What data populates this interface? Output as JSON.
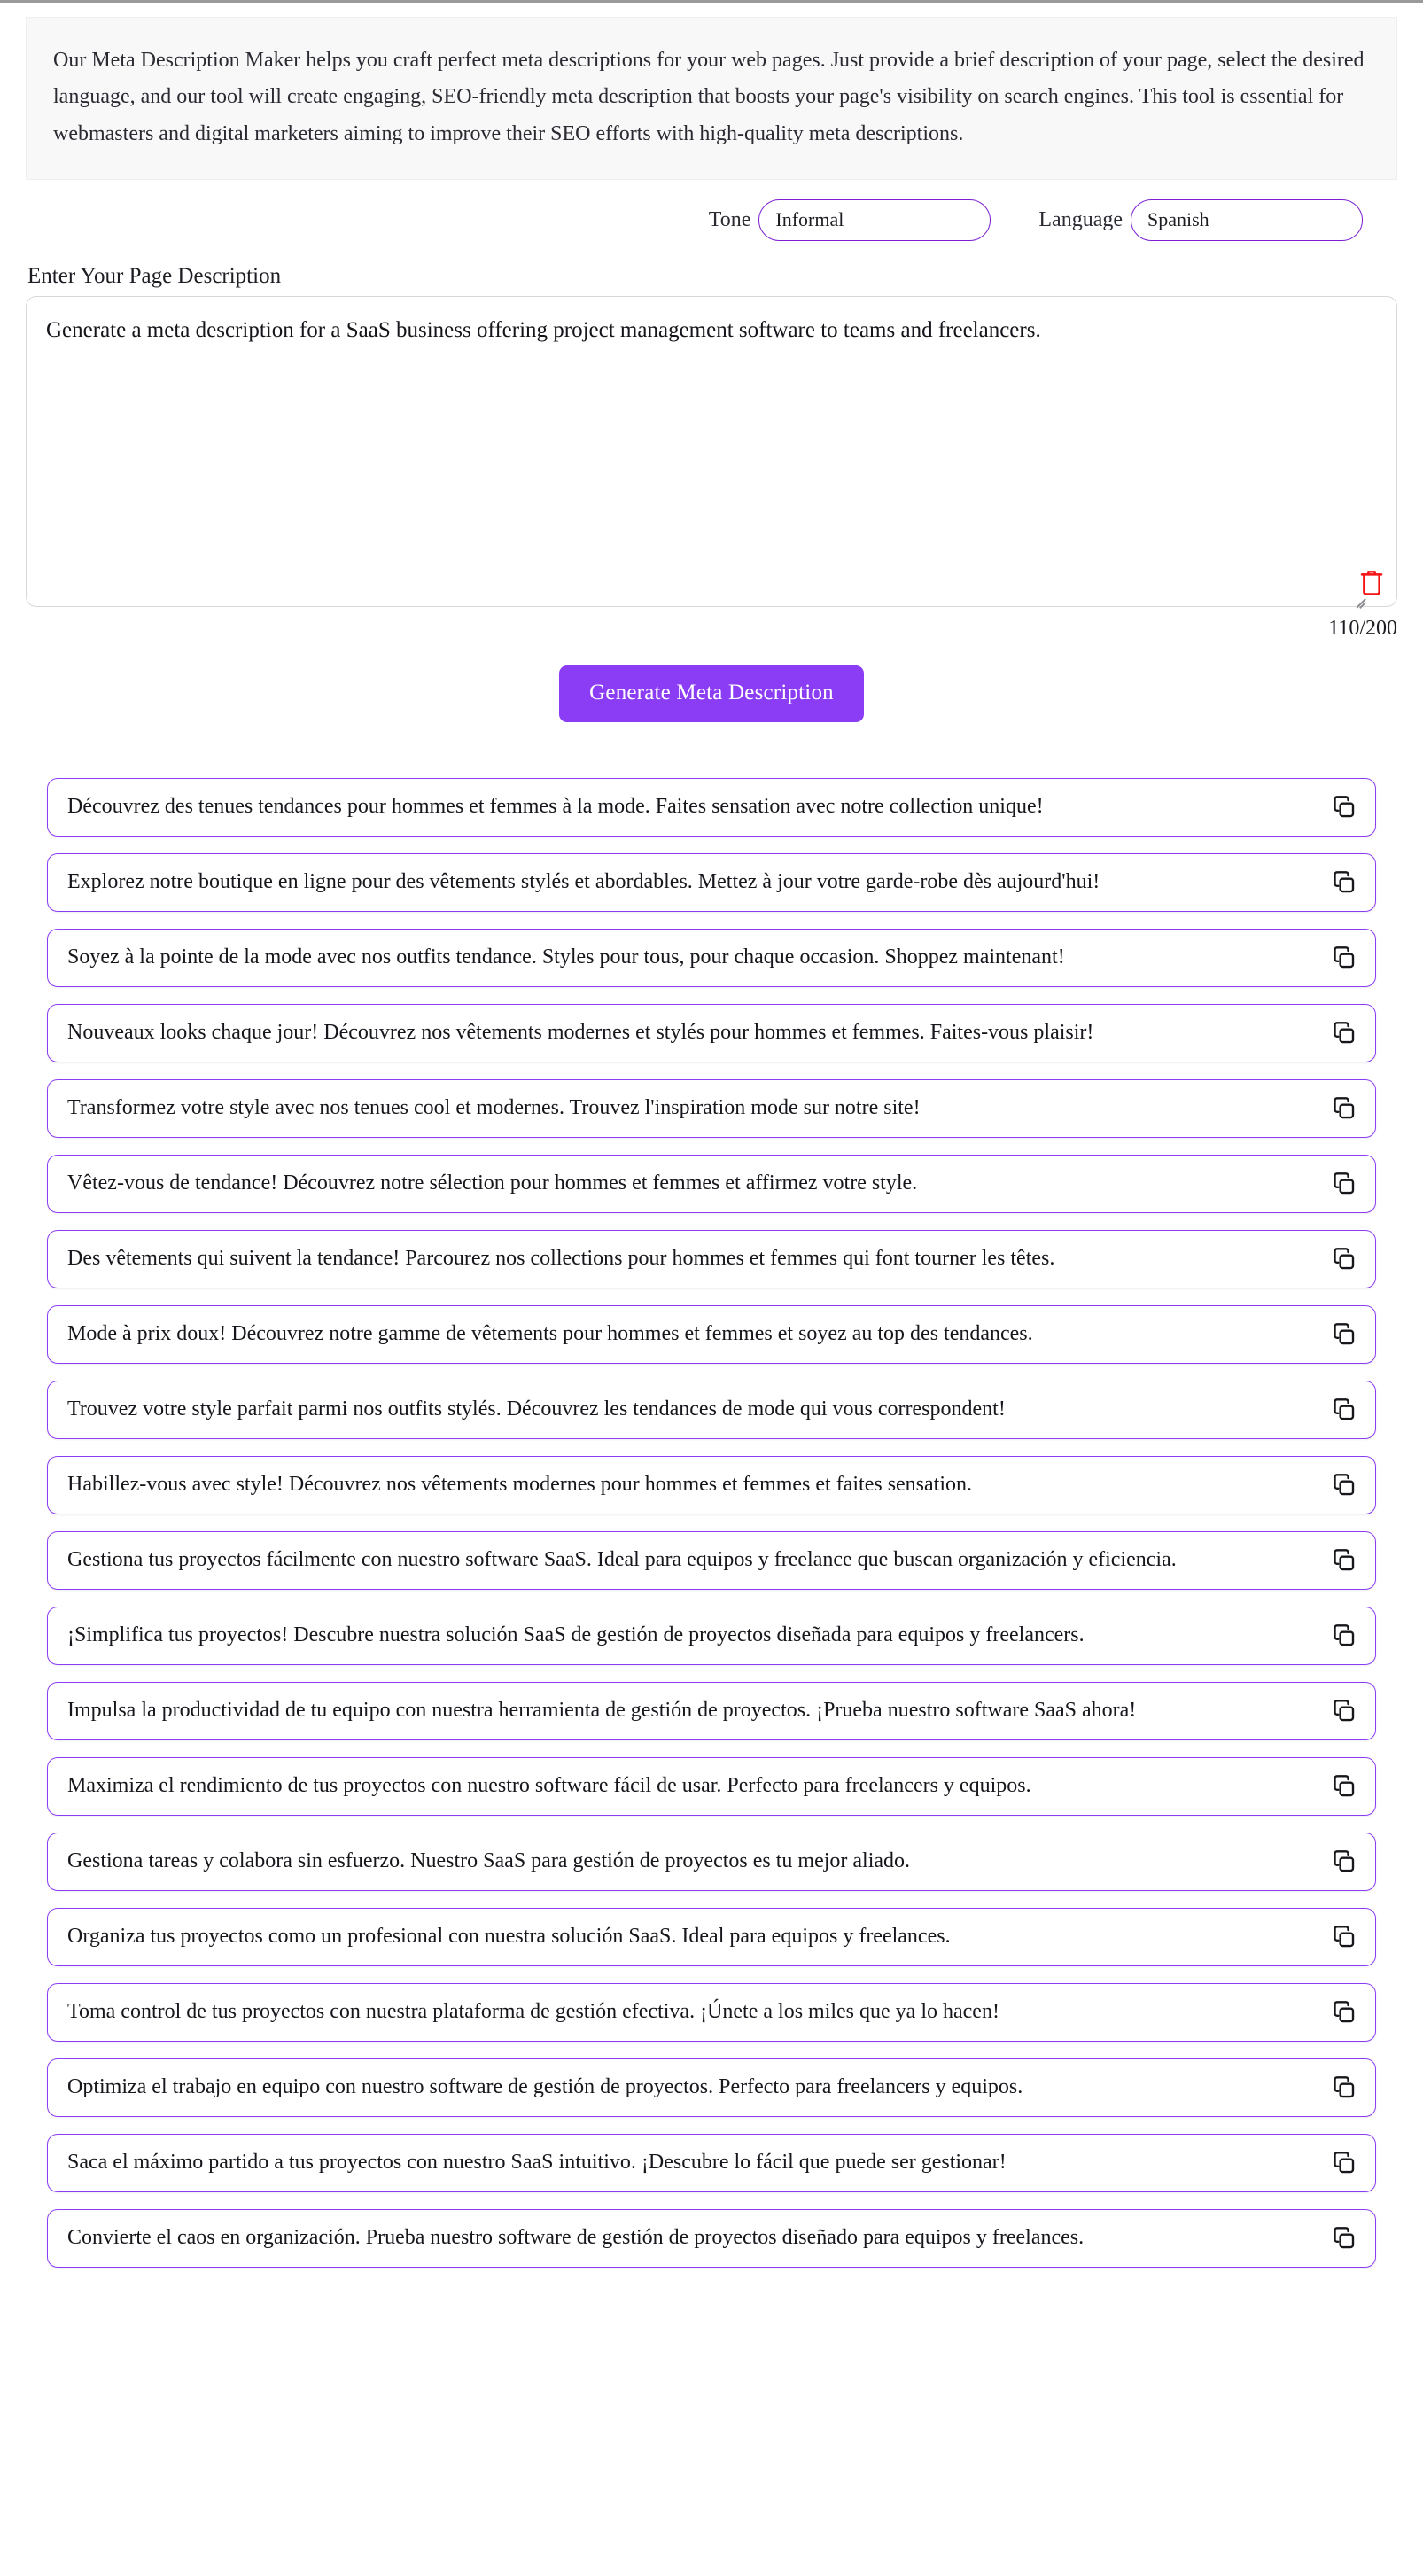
{
  "intro": {
    "text": "Our Meta Description Maker helps you craft perfect meta descriptions for your web pages. Just provide a brief description of your page, select the desired language, and our tool will create engaging, SEO-friendly meta description that boosts your page's visibility on search engines. This tool is essential for webmasters and digital marketers aiming to improve their SEO efforts with high-quality meta descriptions."
  },
  "controls": {
    "tone": {
      "label": "Tone",
      "value": "Informal"
    },
    "language": {
      "label": "Language",
      "value": "Spanish"
    }
  },
  "editor": {
    "label": "Enter Your Page Description",
    "value": "Generate a meta description for a SaaS business offering project management software to teams and freelancers.",
    "placeholder": "Enter Your Page Description",
    "counter": "110/200",
    "clear_icon": "trash-icon",
    "resize_icon": "resize-grip-icon"
  },
  "actions": {
    "generate_label": "Generate Meta Description"
  },
  "colors": {
    "accent": "#8b3df5",
    "select_border": "#7b1fd0",
    "trash": "#f41212",
    "banner_bg": "#f8f8f8"
  },
  "results": {
    "copy_icon": "copy-icon",
    "items": [
      {
        "text": "Découvrez des tenues tendances pour hommes et femmes à la mode. Faites sensation avec notre collection unique!"
      },
      {
        "text": "Explorez notre boutique en ligne pour des vêtements stylés et abordables. Mettez à jour votre garde-robe dès aujourd'hui!"
      },
      {
        "text": "Soyez à la pointe de la mode avec nos outfits tendance. Styles pour tous, pour chaque occasion. Shoppez maintenant!"
      },
      {
        "text": "Nouveaux looks chaque jour! Découvrez nos vêtements modernes et stylés pour hommes et femmes. Faites-vous plaisir!"
      },
      {
        "text": "Transformez votre style avec nos tenues cool et modernes. Trouvez l'inspiration mode sur notre site!"
      },
      {
        "text": "Vêtez-vous de tendance! Découvrez notre sélection pour hommes et femmes et affirmez votre style."
      },
      {
        "text": "Des vêtements qui suivent la tendance! Parcourez nos collections pour hommes et femmes qui font tourner les têtes."
      },
      {
        "text": "Mode à prix doux! Découvrez notre gamme de vêtements pour hommes et femmes et soyez au top des tendances."
      },
      {
        "text": "Trouvez votre style parfait parmi nos outfits stylés. Découvrez les tendances de mode qui vous correspondent!"
      },
      {
        "text": "Habillez-vous avec style! Découvrez nos vêtements modernes pour hommes et femmes et faites sensation."
      },
      {
        "text": "Gestiona tus proyectos fácilmente con nuestro software SaaS. Ideal para equipos y freelance que buscan organización y eficiencia."
      },
      {
        "text": "¡Simplifica tus proyectos! Descubre nuestra solución SaaS de gestión de proyectos diseñada para equipos y freelancers."
      },
      {
        "text": "Impulsa la productividad de tu equipo con nuestra herramienta de gestión de proyectos. ¡Prueba nuestro software SaaS ahora!"
      },
      {
        "text": "Maximiza el rendimiento de tus proyectos con nuestro software fácil de usar. Perfecto para freelancers y equipos."
      },
      {
        "text": "Gestiona tareas y colabora sin esfuerzo. Nuestro SaaS para gestión de proyectos es tu mejor aliado."
      },
      {
        "text": "Organiza tus proyectos como un profesional con nuestra solución SaaS. Ideal para equipos y freelances."
      },
      {
        "text": "Toma control de tus proyectos con nuestra plataforma de gestión efectiva. ¡Únete a los miles que ya lo hacen!"
      },
      {
        "text": "Optimiza el trabajo en equipo con nuestro software de gestión de proyectos. Perfecto para freelancers y equipos."
      },
      {
        "text": "Saca el máximo partido a tus proyectos con nuestro SaaS intuitivo. ¡Descubre lo fácil que puede ser gestionar!"
      },
      {
        "text": "Convierte el caos en organización. Prueba nuestro software de gestión de proyectos diseñado para equipos y freelances."
      }
    ]
  }
}
